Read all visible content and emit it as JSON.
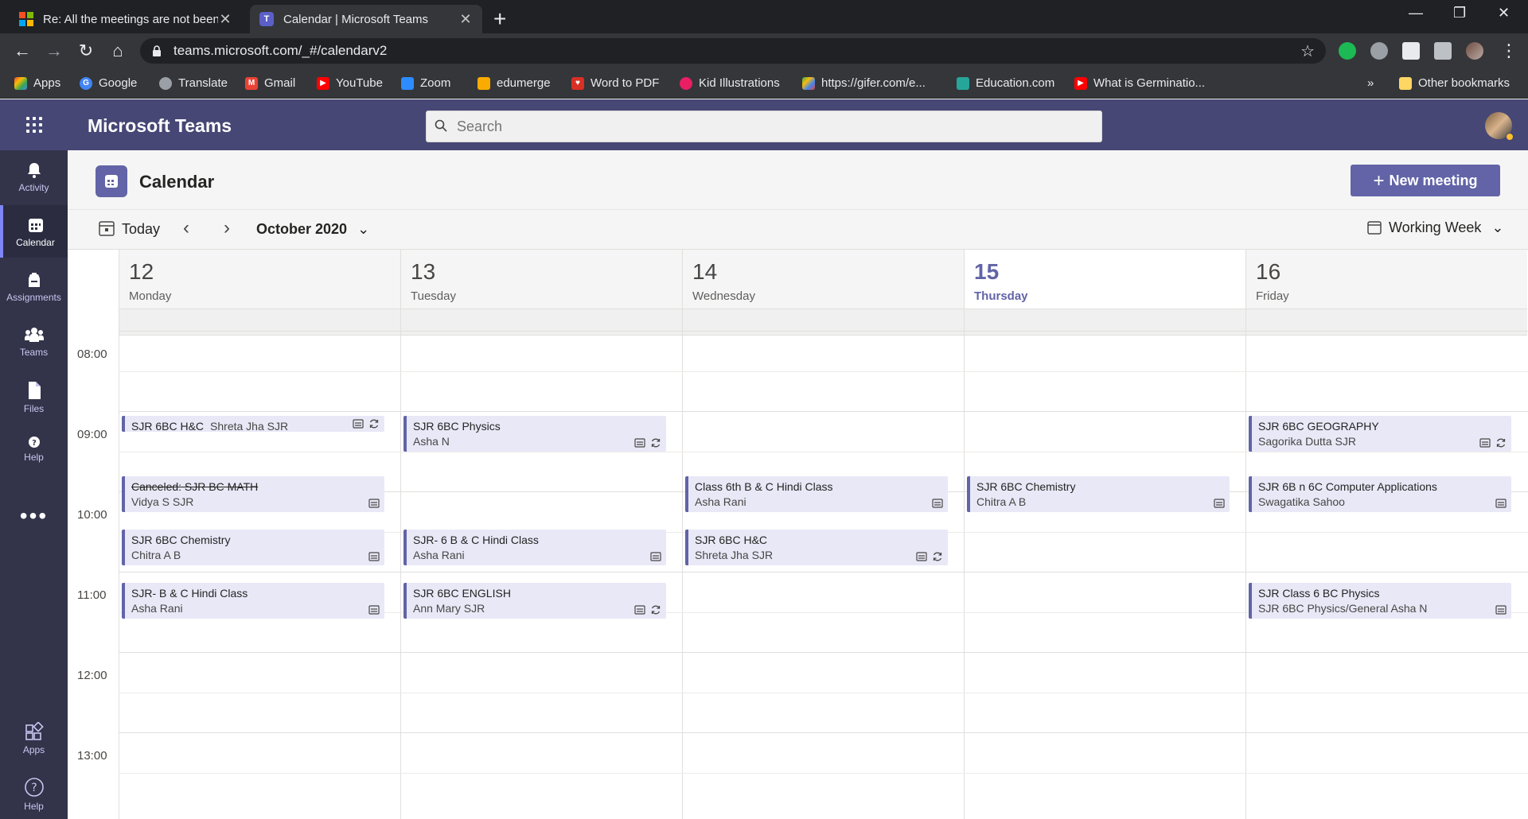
{
  "browser": {
    "tabs": [
      {
        "title": "Re: All the meetings are not been"
      },
      {
        "title": "Calendar | Microsoft Teams"
      }
    ],
    "url": "teams.microsoft.com/_#/calendarv2",
    "bookmarks": [
      {
        "label": "Apps",
        "color": "#ea4335"
      },
      {
        "label": "Google",
        "color": "#4285f4"
      },
      {
        "label": "Translate",
        "color": "#9aa0a6"
      },
      {
        "label": "Gmail",
        "color": "#ea4335"
      },
      {
        "label": "YouTube",
        "color": "#ff0000"
      },
      {
        "label": "Zoom",
        "color": "#2d8cff"
      },
      {
        "label": "edumerge",
        "color": "#f9ab00"
      },
      {
        "label": "Word to PDF",
        "color": "#d93025"
      },
      {
        "label": "Kid Illustrations",
        "color": "#e91e63"
      },
      {
        "label": "https://gifer.com/e...",
        "color": "#34a853"
      },
      {
        "label": "Education.com",
        "color": "#26a69a"
      },
      {
        "label": "What is Germinatio...",
        "color": "#ff0000"
      }
    ],
    "more_bookmarks": "»",
    "other_bookmarks": "Other bookmarks"
  },
  "teams": {
    "app_name": "Microsoft Teams",
    "search_placeholder": "Search",
    "accent": "#6264a7",
    "header_color": "#464775"
  },
  "rail": {
    "items": [
      {
        "label": "Activity",
        "icon": "bell-icon"
      },
      {
        "label": "Calendar",
        "icon": "calendar-icon"
      },
      {
        "label": "Assignments",
        "icon": "assignments-icon"
      },
      {
        "label": "Teams",
        "icon": "teams-icon"
      },
      {
        "label": "Files",
        "icon": "file-icon"
      },
      {
        "label": "Help",
        "icon": "help-icon"
      }
    ],
    "more": "•••",
    "bottom": [
      {
        "label": "Apps",
        "icon": "apps-icon"
      },
      {
        "label": "Help",
        "icon": "help-icon"
      }
    ]
  },
  "calendar": {
    "title": "Calendar",
    "new_meeting": "New meeting",
    "today": "Today",
    "month": "October 2020",
    "view": "Working Week",
    "days": [
      {
        "num": "12",
        "name": "Monday"
      },
      {
        "num": "13",
        "name": "Tuesday"
      },
      {
        "num": "14",
        "name": "Wednesday"
      },
      {
        "num": "15",
        "name": "Thursday",
        "today": true
      },
      {
        "num": "16",
        "name": "Friday"
      }
    ],
    "times": [
      "08:00",
      "09:00",
      "10:00",
      "11:00",
      "12:00",
      "13:00"
    ],
    "events": [
      {
        "day": 0,
        "title": "SJR 6BC H&C",
        "sub": "Shreta Jha SJR",
        "start": "09:00",
        "short": true,
        "recurring": true
      },
      {
        "day": 0,
        "title": "Canceled: SJR BC MATH",
        "sub": "Vidya S SJR",
        "start": "09:45",
        "canceled": true
      },
      {
        "day": 0,
        "title": "SJR 6BC Chemistry",
        "sub": "Chitra A B",
        "start": "10:25"
      },
      {
        "day": 0,
        "title": "SJR- B & C Hindi Class",
        "sub": "Asha Rani",
        "start": "11:05"
      },
      {
        "day": 1,
        "title": "SJR 6BC Physics",
        "sub": "Asha N",
        "start": "09:00",
        "recurring": true
      },
      {
        "day": 1,
        "title": "SJR- 6 B & C Hindi Class",
        "sub": "Asha Rani",
        "start": "10:25"
      },
      {
        "day": 1,
        "title": "SJR 6BC ENGLISH",
        "sub": "Ann Mary SJR",
        "start": "11:05",
        "recurring": true
      },
      {
        "day": 2,
        "title": "Class 6th B & C Hindi Class",
        "sub": "Asha Rani",
        "start": "09:45"
      },
      {
        "day": 2,
        "title": "SJR 6BC H&C",
        "sub": "Shreta Jha SJR",
        "start": "10:25",
        "recurring": true
      },
      {
        "day": 3,
        "title": "SJR 6BC Chemistry",
        "sub": "Chitra A B",
        "start": "09:45"
      },
      {
        "day": 4,
        "title": "SJR 6BC GEOGRAPHY",
        "sub": "Sagorika Dutta SJR",
        "start": "09:00",
        "recurring": true
      },
      {
        "day": 4,
        "title": "SJR 6B n 6C Computer Applications",
        "sub": "Swagatika Sahoo",
        "start": "09:45"
      },
      {
        "day": 4,
        "title": "SJR Class 6 BC Physics",
        "sub": "SJR 6BC Physics/General   Asha N",
        "start": "11:05"
      }
    ]
  }
}
